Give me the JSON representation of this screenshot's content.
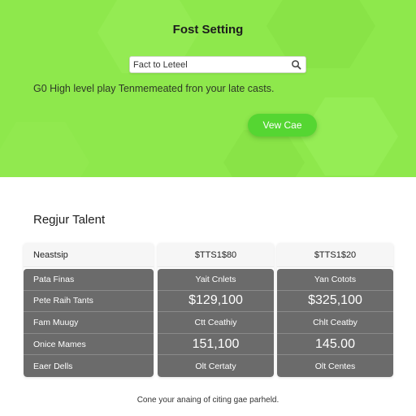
{
  "hero": {
    "title": "Fost Setting",
    "search": {
      "value": "Fact to Leteel",
      "icon": "search-icon"
    },
    "subtitle": "G0 High level play Tenmemeated fron your late casts.",
    "cta_label": "Vew Cae",
    "colors": {
      "background": "#8ee84c",
      "cta": "#55d632"
    }
  },
  "section": {
    "title": "Regjur Talent"
  },
  "table": {
    "headers": [
      "Neastsip",
      "$TTS1$80",
      "$TTS1$20"
    ],
    "rows": [
      [
        "Pata Finas",
        "Yait Cnlets",
        "Yan Cotots"
      ],
      [
        "Pete Raih Tants",
        "$129,100",
        "$325,100"
      ],
      [
        "Fam Muugy",
        "Ctt Ceathiy",
        "Chlt Ceatby"
      ],
      [
        "Onice Mames",
        "151,100",
        "145.00"
      ],
      [
        "Eaer Dells",
        "Olt Certaty",
        "Olt Centes"
      ]
    ]
  },
  "footer": {
    "line1": "Cone your anaing of citing gae parheld.",
    "line2": "..."
  }
}
